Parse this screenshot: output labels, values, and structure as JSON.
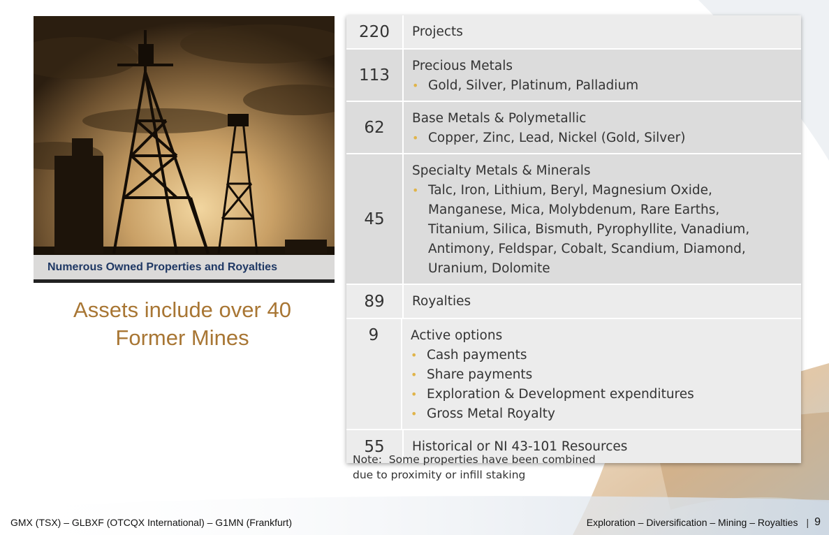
{
  "photo": {
    "caption": "Numerous Owned Properties and Royalties"
  },
  "headline": {
    "line1": "Assets include over 40",
    "line2": "Former Mines"
  },
  "stats": [
    {
      "value": "220",
      "title": "Projects",
      "items": []
    },
    {
      "value": "113",
      "title": "Precious Metals",
      "items": [
        "Gold, Silver, Platinum, Palladium"
      ]
    },
    {
      "value": "62",
      "title": "Base Metals & Polymetallic",
      "items": [
        "Copper, Zinc, Lead, Nickel (Gold, Silver)"
      ]
    },
    {
      "value": "45",
      "title": "Specialty Metals & Minerals",
      "items": [
        "Talc, Iron, Lithium,  Beryl, Magnesium  Oxide, Manganese, Mica, Molybdenum, Rare Earths, Titanium, Silica, Bismuth, Pyrophyllite, Vanadium, Antimony, Feldspar, Cobalt, Scandium, Diamond, Uranium, Dolomite"
      ]
    },
    {
      "value": "89",
      "title": "Royalties",
      "items": []
    },
    {
      "value": "9",
      "title": "Active options",
      "items": [
        "Cash payments",
        "Share payments",
        "Exploration & Development expenditures",
        "Gross Metal Royalty"
      ]
    },
    {
      "value": "55",
      "title": "Historical or NI 43-101 Resources",
      "items": []
    }
  ],
  "note": {
    "line1": "Note:  Some properties have been combined",
    "line2": "due to proximity or infill staking"
  },
  "footer": {
    "left": "GMX (TSX) – GLBXF (OTCQX International) – G1MN (Frankfurt)",
    "right": "Exploration – Diversification – Mining – Royalties",
    "separator": "|",
    "page": "9"
  },
  "colors": {
    "headline": "#a87634",
    "caption": "#1f3864",
    "bullet": "#e0b44a"
  }
}
